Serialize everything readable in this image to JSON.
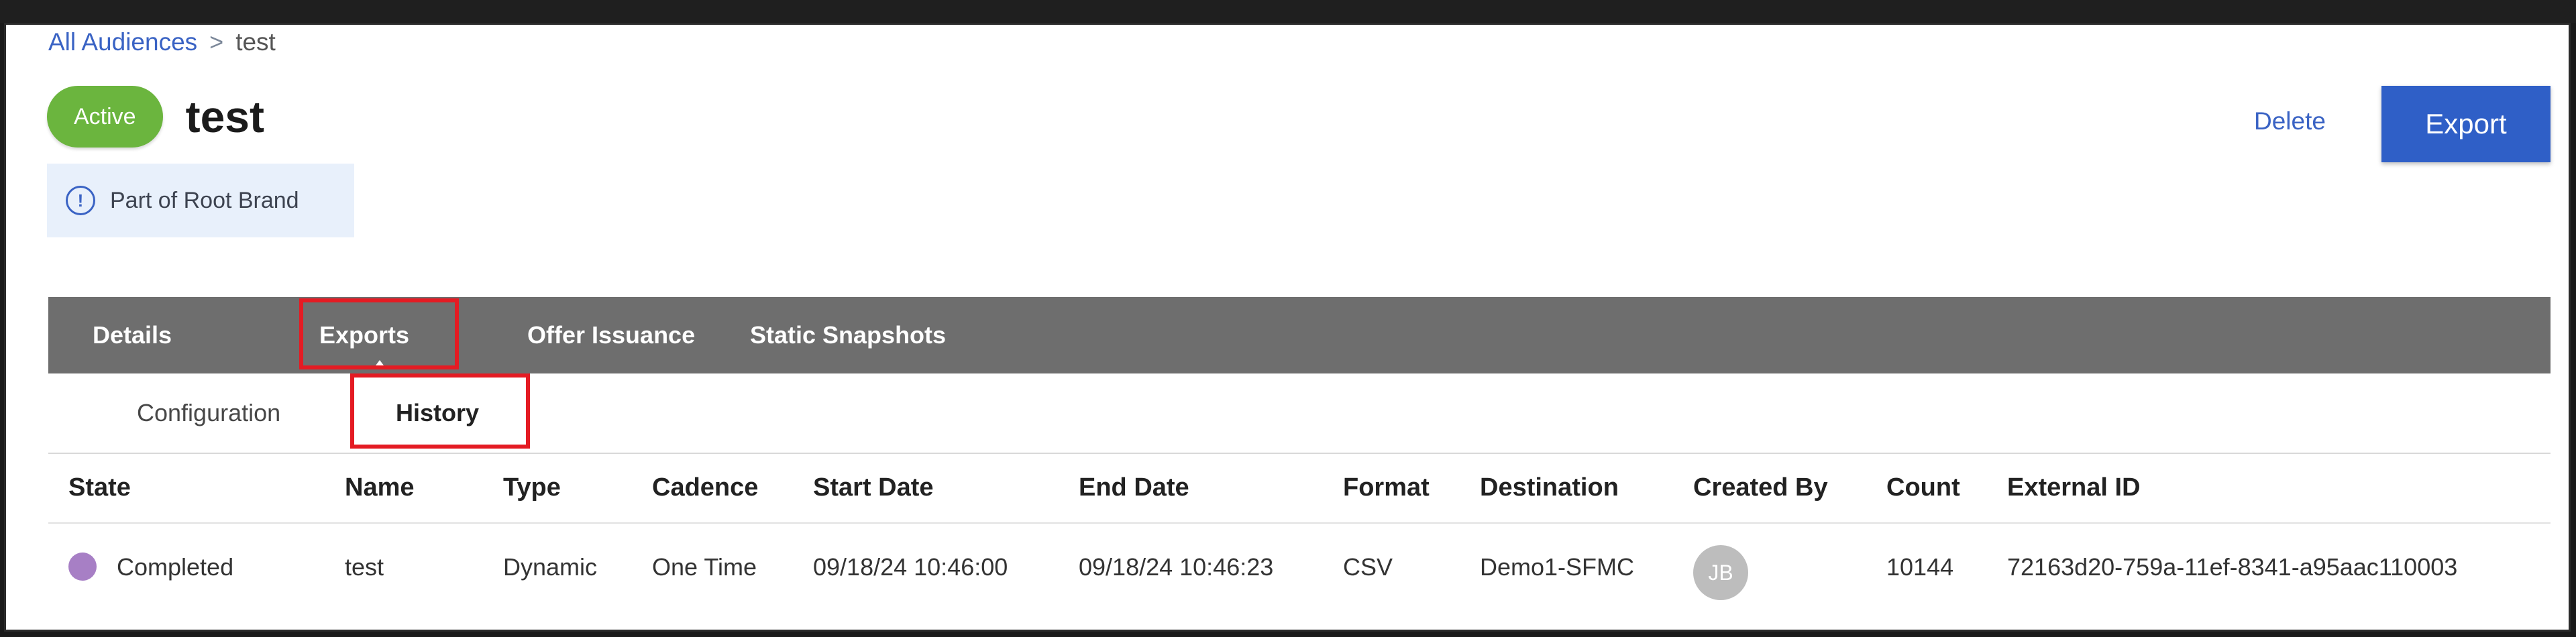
{
  "breadcrumb": {
    "root": "All Audiences",
    "separator": ">",
    "current": "test"
  },
  "header": {
    "status": "Active",
    "title": "test"
  },
  "brand_note": {
    "text": "Part of Root Brand"
  },
  "actions": {
    "delete": "Delete",
    "export": "Export"
  },
  "tabs": [
    {
      "label": "Details"
    },
    {
      "label": "Exports"
    },
    {
      "label": "Offer Issuance"
    },
    {
      "label": "Static Snapshots"
    }
  ],
  "subtabs": [
    {
      "label": "Configuration"
    },
    {
      "label": "History"
    }
  ],
  "table": {
    "headers": [
      "State",
      "Name",
      "Type",
      "Cadence",
      "Start Date",
      "End Date",
      "Format",
      "Destination",
      "Created By",
      "Count",
      "External ID"
    ],
    "rows": [
      {
        "state": "Completed",
        "name": "test",
        "type": "Dynamic",
        "cadence": "One Time",
        "start_date": "09/18/24 10:46:00",
        "end_date": "09/18/24 10:46:23",
        "format": "CSV",
        "destination": "Demo1-SFMC",
        "created_by": "JB",
        "count": "10144",
        "external_id": "72163d20-759a-11ef-8341-a95aac110003"
      }
    ]
  },
  "colors": {
    "active_pill": "#6bb53e",
    "primary_button": "#2f5fc7",
    "tab_bar": "#6e6e6e",
    "highlight_box": "#e41b23",
    "state_completed": "#a77fc5"
  },
  "icons": {
    "info": "info-circle-icon",
    "tab_indicator": "caret-up-icon"
  }
}
